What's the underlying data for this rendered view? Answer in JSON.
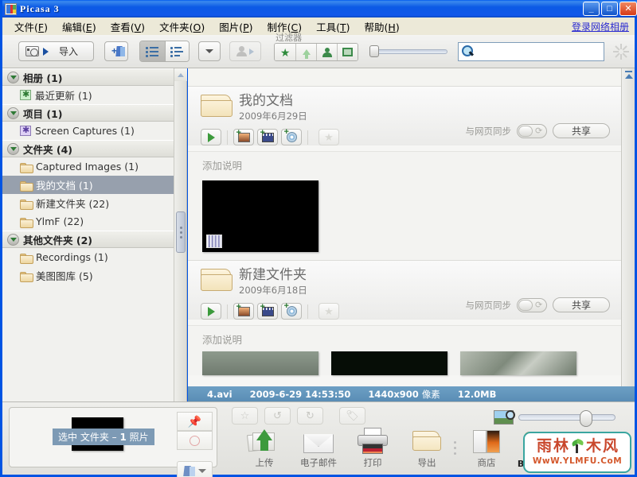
{
  "window": {
    "title": "Picasa 3",
    "minimize": "_",
    "maximize": "□",
    "close": "✕"
  },
  "menubar": {
    "items": [
      {
        "label": "文件",
        "accel": "F"
      },
      {
        "label": "编辑",
        "accel": "E"
      },
      {
        "label": "查看",
        "accel": "V"
      },
      {
        "label": "文件夹",
        "accel": "O"
      },
      {
        "label": "图片",
        "accel": "P"
      },
      {
        "label": "制作",
        "accel": "C"
      },
      {
        "label": "工具",
        "accel": "T"
      },
      {
        "label": "帮助",
        "accel": "H"
      }
    ],
    "login_link": "登录网络相册"
  },
  "toolbar": {
    "import_label": "导入",
    "filter_label": "过滤器",
    "search_value": "",
    "search_placeholder": "",
    "icons": {
      "camera": "camera-icon",
      "add_album": "add-album-icon",
      "list_view": "list-view-icon",
      "detail_view": "detail-view-icon",
      "dropdown": "chevron-down-icon",
      "faces": "face-icon",
      "filter_star": "star-filter-icon",
      "filter_upload": "upload-filter-icon",
      "filter_people": "people-filter-icon",
      "filter_video": "video-filter-icon",
      "search": "search-icon",
      "spinner": "spinner-icon"
    }
  },
  "sidebar": {
    "groups": [
      {
        "title": "相册 (1)",
        "nodes": [
          {
            "label": "最近更新 (1)",
            "icon": "green-star-album-icon",
            "selected": false
          }
        ]
      },
      {
        "title": "项目 (1)",
        "nodes": [
          {
            "label": "Screen Captures (1)",
            "icon": "purple-star-album-icon",
            "selected": false
          }
        ]
      },
      {
        "title": "文件夹 (4)",
        "nodes": [
          {
            "label": "Captured Images (1)",
            "icon": "folder-icon",
            "selected": false
          },
          {
            "label": "我的文档 (1)",
            "icon": "folder-icon",
            "selected": true
          },
          {
            "label": "新建文件夹 (22)",
            "icon": "folder-icon",
            "selected": false
          },
          {
            "label": "YlmF (22)",
            "icon": "folder-icon",
            "selected": false
          }
        ]
      },
      {
        "title": "其他文件夹 (2)",
        "nodes": [
          {
            "label": "Recordings (1)",
            "icon": "folder-icon",
            "selected": false
          },
          {
            "label": "美图图库 (5)",
            "icon": "folder-icon",
            "selected": false
          }
        ]
      }
    ]
  },
  "content": {
    "folders": [
      {
        "name": "我的文档",
        "date": "2009年6月29日",
        "caption_placeholder": "添加说明",
        "sync_label": "与网页同步",
        "share_label": "共享"
      },
      {
        "name": "新建文件夹",
        "date": "2009年6月18日",
        "caption_placeholder": "添加说明",
        "sync_label": "与网页同步",
        "share_label": "共享"
      }
    ]
  },
  "statusbar": {
    "filename": "4.avi",
    "datetime": "2009-6-29 14:53:50",
    "dimensions": "1440x900",
    "dimensions_unit": "像素",
    "filesize": "12.0MB"
  },
  "tray": {
    "basket_message_prefix": "选中 文件夹 – ",
    "basket_message_count": "1",
    "basket_message_suffix": " 照片",
    "actions": [
      {
        "label": "上传",
        "icon": "upload-icon"
      },
      {
        "label": "电子邮件",
        "icon": "email-icon"
      },
      {
        "label": "打印",
        "icon": "print-icon"
      },
      {
        "label": "导出",
        "icon": "export-icon"
      },
      {
        "label": "商店",
        "icon": "shop-icon"
      },
      {
        "label": "BlogThis!",
        "icon": "blogthis-icon"
      }
    ],
    "tools": [
      {
        "icon": "star-icon"
      },
      {
        "icon": "rotate-left-icon"
      },
      {
        "icon": "rotate-right-icon"
      },
      {
        "icon": "tag-icon"
      }
    ]
  },
  "watermark": {
    "char1": "雨",
    "char2": "林",
    "char3": "木",
    "char4": "风",
    "url": "WwW.YLMFU.CoM"
  }
}
